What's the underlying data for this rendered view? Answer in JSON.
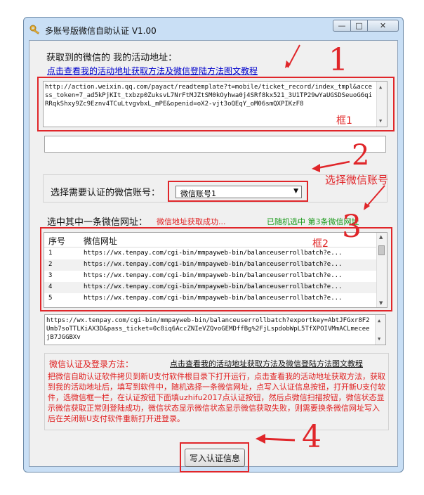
{
  "window": {
    "title": "多账号版微信自助认证 V1.00",
    "minimize": "—",
    "maximize": "□",
    "close": "✕"
  },
  "activity": {
    "heading": "获取到的微信的 我的活动地址：",
    "help_link": "点击查看我的活动地址获取方法及微信登陆方法图文教程",
    "url_text": "http://action.weixin.qq.com/payact/readtemplate?t=mobile/ticket_record/index_tmpl&access_token=7_ad5kPjKIt_txbzp0ZuksvL7NrFtMJZtSM0kOyhwa0j4SRf8kx521_3U1TP29wYaUGSDSeuoG6qiRRqkShxy9Zc9Eznv4TCuLtvgvbxL_mPE&openid=oX2-vjt3oQEqY_oM06smQXPIKzF8",
    "frame_note": "框1"
  },
  "account": {
    "label": "选择需要认证的微信账号：",
    "selected": "微信账号1"
  },
  "url_list": {
    "label": "选中其中一条微信网址：",
    "status_red": "微信地址获取成功...",
    "status_green": "已随机选中 第3条微信网址",
    "frame_note": "框2",
    "columns": [
      "序号",
      "微信网址"
    ],
    "rows": [
      {
        "no": "1",
        "url": "https://wx.tenpay.com/cgi-bin/mmpayweb-bin/balanceuserrollbatch?e..."
      },
      {
        "no": "2",
        "url": "https://wx.tenpay.com/cgi-bin/mmpayweb-bin/balanceuserrollbatch?e..."
      },
      {
        "no": "3",
        "url": "https://wx.tenpay.com/cgi-bin/mmpayweb-bin/balanceuserrollbatch?e..."
      },
      {
        "no": "4",
        "url": "https://wx.tenpay.com/cgi-bin/mmpayweb-bin/balanceuserrollbatch?e..."
      },
      {
        "no": "5",
        "url": "https://wx.tenpay.com/cgi-bin/mmpayweb-bin/balanceuserrollbatch?e..."
      }
    ],
    "selected_url": "https://wx.tenpay.com/cgi-bin/mmpayweb-bin/balanceuserrollbatch?exportkey=AbtJFGxr8F2Umb7soTTLKiAX3D&pass_ticket=0c8iq6AccZNIeVZQvoGEMDffBg%2FjLspdobWpL5TfXPOIVMmACLmeceejB7JGGBXv"
  },
  "instructions": {
    "heading": "微信认证及登录方法：",
    "link": "点击查看我的活动地址获取方法及微信登陆方法图文教程",
    "body": "把微信自助认证软件拷贝到新U支付软件根目录下打开运行，点击查看我的活动地址获取方法，获取到我的活动地址后，填写到软件中，随机选择一条微信网址，点写入认证信息按钮，打开新U支付软件，选微信框一栏，在认证按钮下面填uzhifu2017点认证按钮，然后点微信扫描按钮，微信状态显示微信获取正常则登陆成功，微信状态显示微信状态显示微信获取失败，则需要换条微信网址写入后在关闭新U支付软件重新打开进登录。"
  },
  "write_button": "写入认证信息",
  "annotations": {
    "step1": "1",
    "step2": "2",
    "step3": "3",
    "step4": "4",
    "choose_account": "选择微信账号"
  },
  "colors": {
    "annotation_red": "#e0262a",
    "status_green": "#1a9a1a",
    "link_blue": "#0000cc"
  }
}
